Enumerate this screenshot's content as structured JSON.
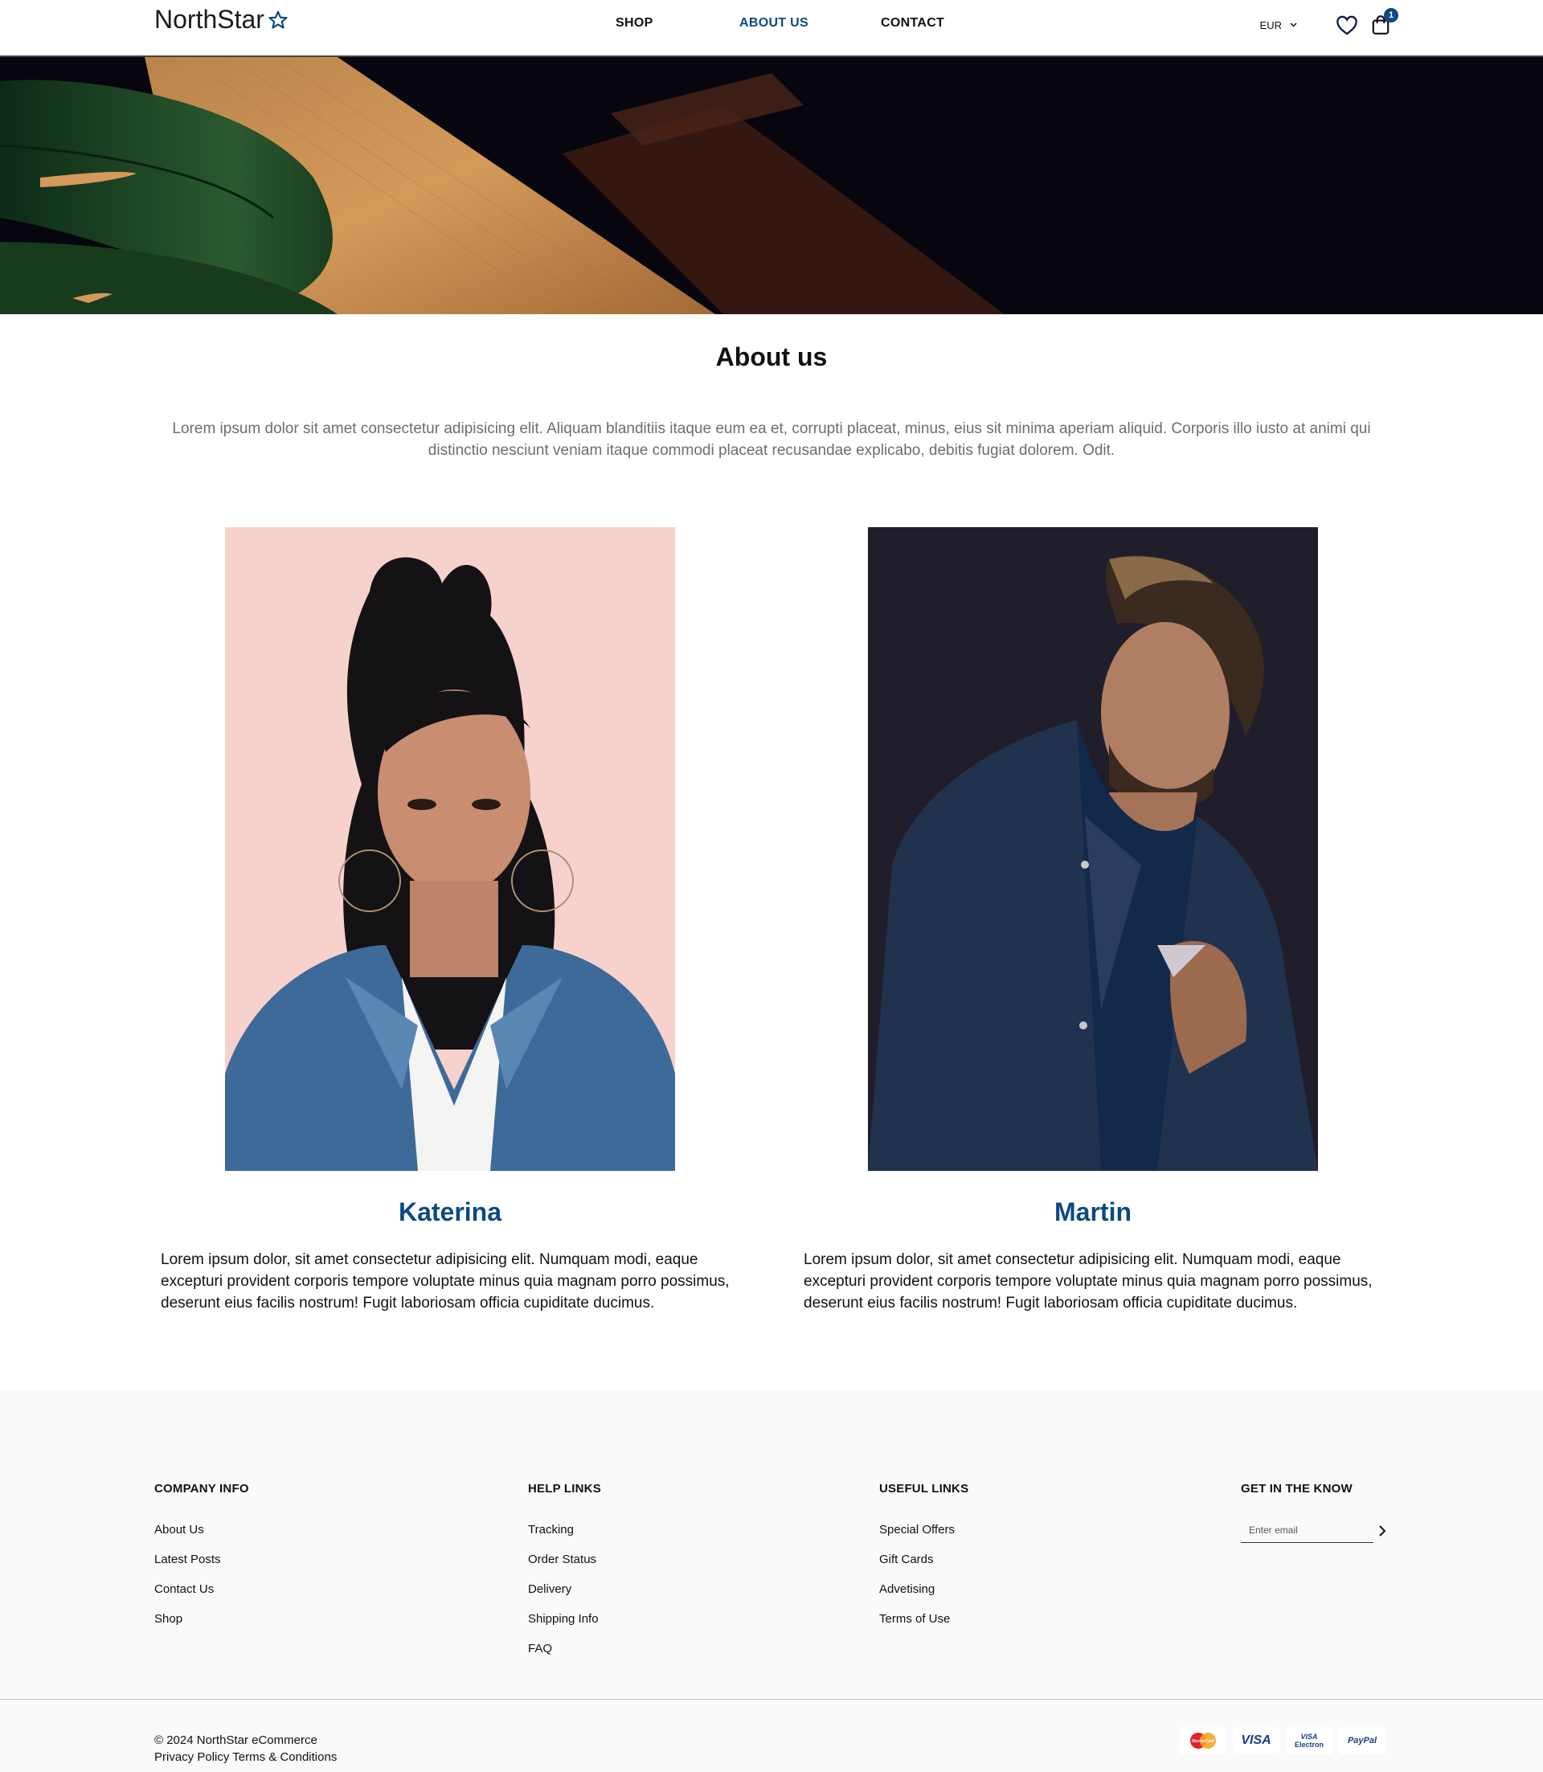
{
  "header": {
    "logo_text": "NorthStar",
    "nav": [
      {
        "label": "SHOP",
        "active": false
      },
      {
        "label": "ABOUT US",
        "active": true
      },
      {
        "label": "CONTACT",
        "active": false
      }
    ],
    "currency": "EUR",
    "cart_count": "1"
  },
  "about": {
    "title": "About us",
    "text": "Lorem ipsum dolor sit amet consectetur adipisicing elit. Aliquam blanditiis itaque eum ea et, corrupti placeat, minus, eius sit minima aperiam aliquid. Corporis illo iusto at animi qui distinctio nesciunt veniam itaque commodi placeat recusandae explicabo, debitis fugiat dolorem. Odit."
  },
  "team": [
    {
      "name": "Katerina",
      "bio": "Lorem ipsum dolor, sit amet consectetur adipisicing elit. Numquam modi, eaque excepturi provident corporis tempore voluptate minus quia magnam porro possimus, deserunt eius facilis nostrum! Fugit laboriosam officia cupiditate ducimus."
    },
    {
      "name": "Martin",
      "bio": "Lorem ipsum dolor, sit amet consectetur adipisicing elit. Numquam modi, eaque excepturi provident corporis tempore voluptate minus quia magnam porro possimus, deserunt eius facilis nostrum! Fugit laboriosam officia cupiditate ducimus."
    }
  ],
  "footer": {
    "company": {
      "title": "COMPANY INFO",
      "links": [
        "About Us",
        "Latest Posts",
        "Contact Us",
        "Shop"
      ]
    },
    "help": {
      "title": "HELP LINKS",
      "links": [
        "Tracking",
        "Order Status",
        "Delivery",
        "Shipping Info",
        "FAQ"
      ]
    },
    "useful": {
      "title": "USEFUL LINKS",
      "links": [
        "Special Offers",
        "Gift Cards",
        "Advetising",
        "Terms of Use"
      ]
    },
    "newsletter": {
      "title": "GET IN THE KNOW",
      "placeholder": "Enter email"
    },
    "copyright": "© 2024 NorthStar eCommerce",
    "privacy": "Privacy Policy",
    "terms": "Terms & Conditions",
    "payments": {
      "visa": "VISA",
      "visa_electron_top": "VISA",
      "visa_electron_bottom": "Electron",
      "paypal": "PayPal",
      "mastercard": "MasterCard"
    }
  },
  "colors": {
    "accent": "#0b4a82",
    "footer_bg": "#fafafa",
    "body_text": "#111111",
    "muted_text": "#6d6d6d"
  }
}
